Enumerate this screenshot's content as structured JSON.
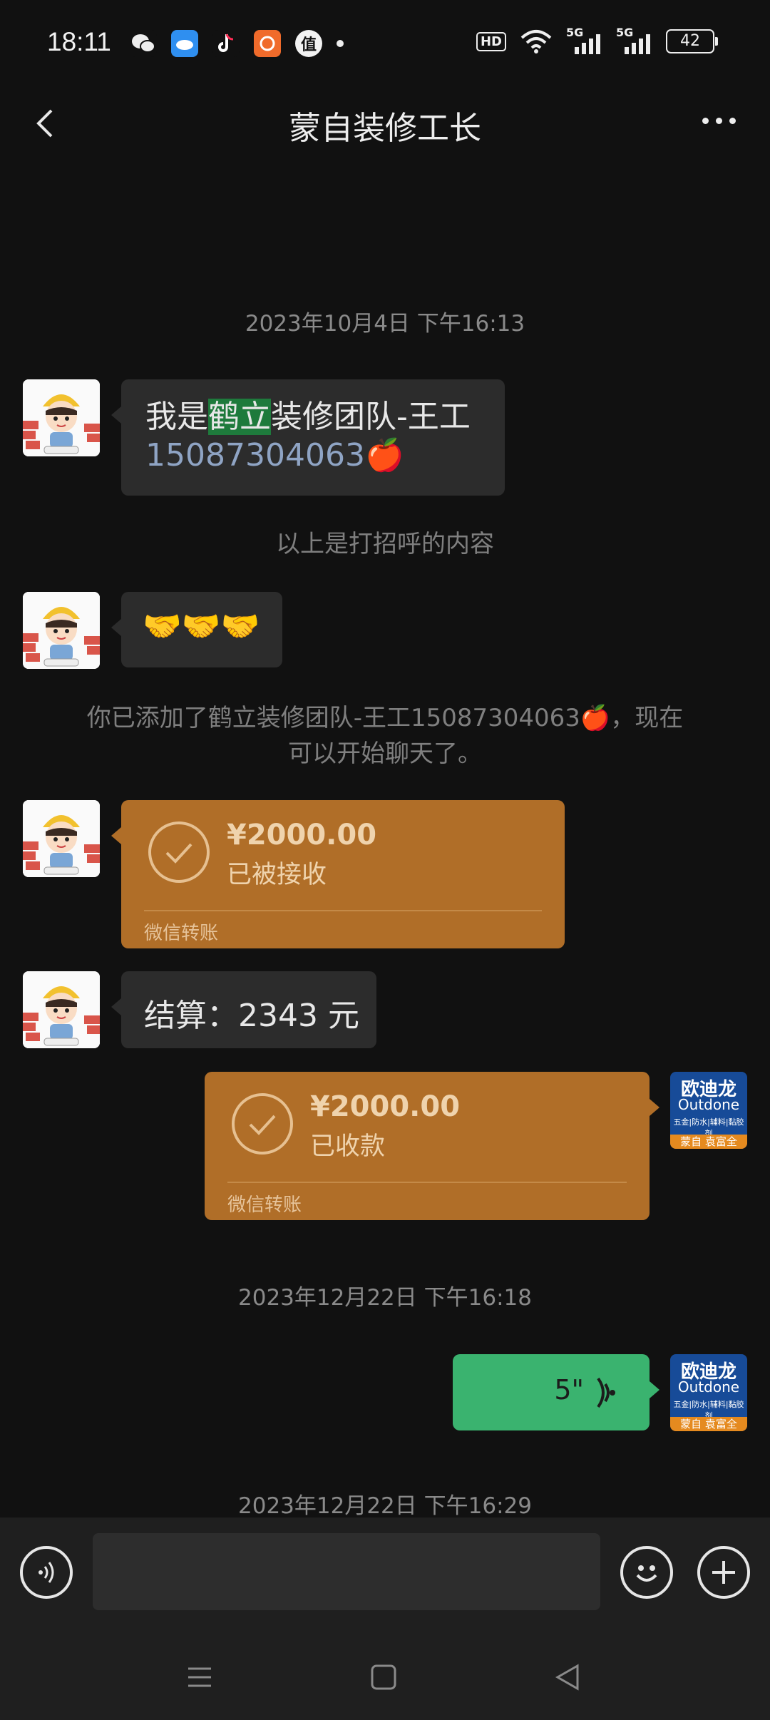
{
  "status_bar": {
    "time": "18:11",
    "app_icons": [
      "wechat-icon",
      "weather-icon",
      "douyin-icon",
      "app-icon",
      "zhi-icon"
    ],
    "hd_label": "HD",
    "net1": "5G",
    "net2": "5G",
    "battery": "42"
  },
  "header": {
    "title": "蒙自装修工长"
  },
  "messages": {
    "time1": "2023年10月4日 下午16:13",
    "greeting_pre": "我是",
    "greeting_hl": "鹤立",
    "greeting_post": "装修团队-王工",
    "greeting_phone": "15087304063",
    "greeting_emoji": "🍎",
    "sys1": "以上是打招呼的内容",
    "handshake": "🤝🤝🤝",
    "sys2_line1": "你已添加了鹤立装修团队-王工15087304063🍎，现在",
    "sys2_line2": "可以开始聊天了。",
    "transfer1_amount": "¥2000.00",
    "transfer1_status": "已被接收",
    "transfer1_footer": "微信转账",
    "settle": "结算：2343 元",
    "transfer2_amount": "¥2000.00",
    "transfer2_status": "已收款",
    "transfer2_footer": "微信转账",
    "time2": "2023年12月22日 下午16:18",
    "voice_length": "5\"",
    "time3": "2023年12月22日 下午16:29"
  },
  "brand_avatar": {
    "line1": "欧迪龙",
    "line2": "Outdone",
    "line3": "五金|防水|辅料|黏胶剂",
    "line4": "蒙自 袁富全"
  },
  "input": {
    "placeholder": ""
  },
  "colors": {
    "background": "#111111",
    "bubble": "#2c2c2c",
    "transfer": "#b06e28",
    "voice": "#3ab36f",
    "highlight": "#1e7a3c"
  }
}
